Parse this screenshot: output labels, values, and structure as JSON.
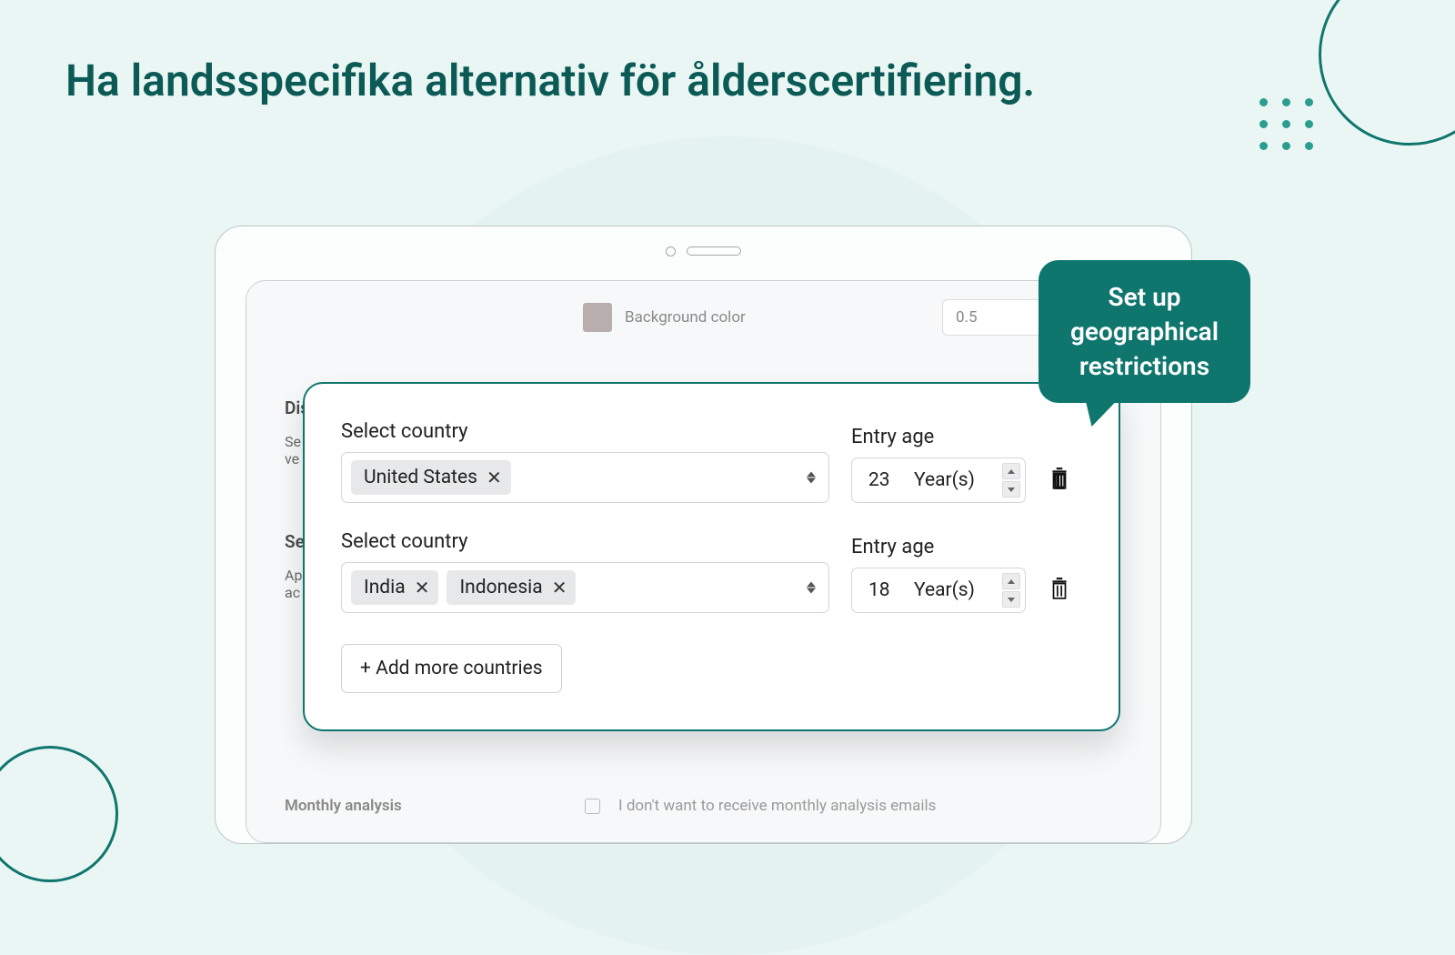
{
  "headline": "Ha landsspecifika alternativ för ålderscertifiering.",
  "background_row": {
    "label": "Background color",
    "value": "0.5"
  },
  "faded_sections": {
    "s1_title": "Dis",
    "s1_line1": "Se",
    "s1_line2": "ve",
    "s2_title": "Se",
    "s2_line1": "Ap",
    "s2_line2": "ac"
  },
  "monthly": {
    "title": "Monthly analysis",
    "opt_out": "I don't want to receive monthly analysis emails"
  },
  "modal": {
    "select_country_label": "Select country",
    "entry_age_label": "Entry age",
    "years_unit": "Year(s)",
    "rows": [
      {
        "countries": [
          "United States"
        ],
        "age": "23"
      },
      {
        "countries": [
          "India",
          "Indonesia"
        ],
        "age": "18"
      }
    ],
    "add_more": "+ Add more countries"
  },
  "callout": "Set up geographical restrictions"
}
